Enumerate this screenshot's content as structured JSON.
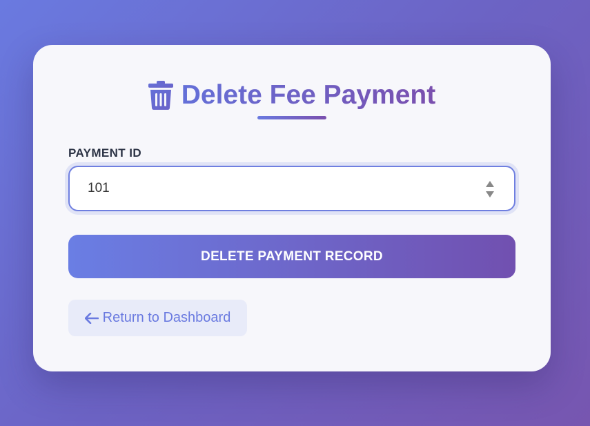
{
  "page": {
    "title": "Delete Fee Payment",
    "title_icon": "trash-icon"
  },
  "form": {
    "payment_id_label": "PAYMENT ID",
    "payment_id_value": "101",
    "submit_label": "DELETE PAYMENT RECORD"
  },
  "nav": {
    "back_label": "Return to Dashboard",
    "back_icon": "arrow-left-icon"
  },
  "colors": {
    "accent_start": "#6a7ae0",
    "accent_end": "#7a4fae",
    "card_background": "#f7f7fb",
    "back_button_background": "#e8ebf9"
  }
}
